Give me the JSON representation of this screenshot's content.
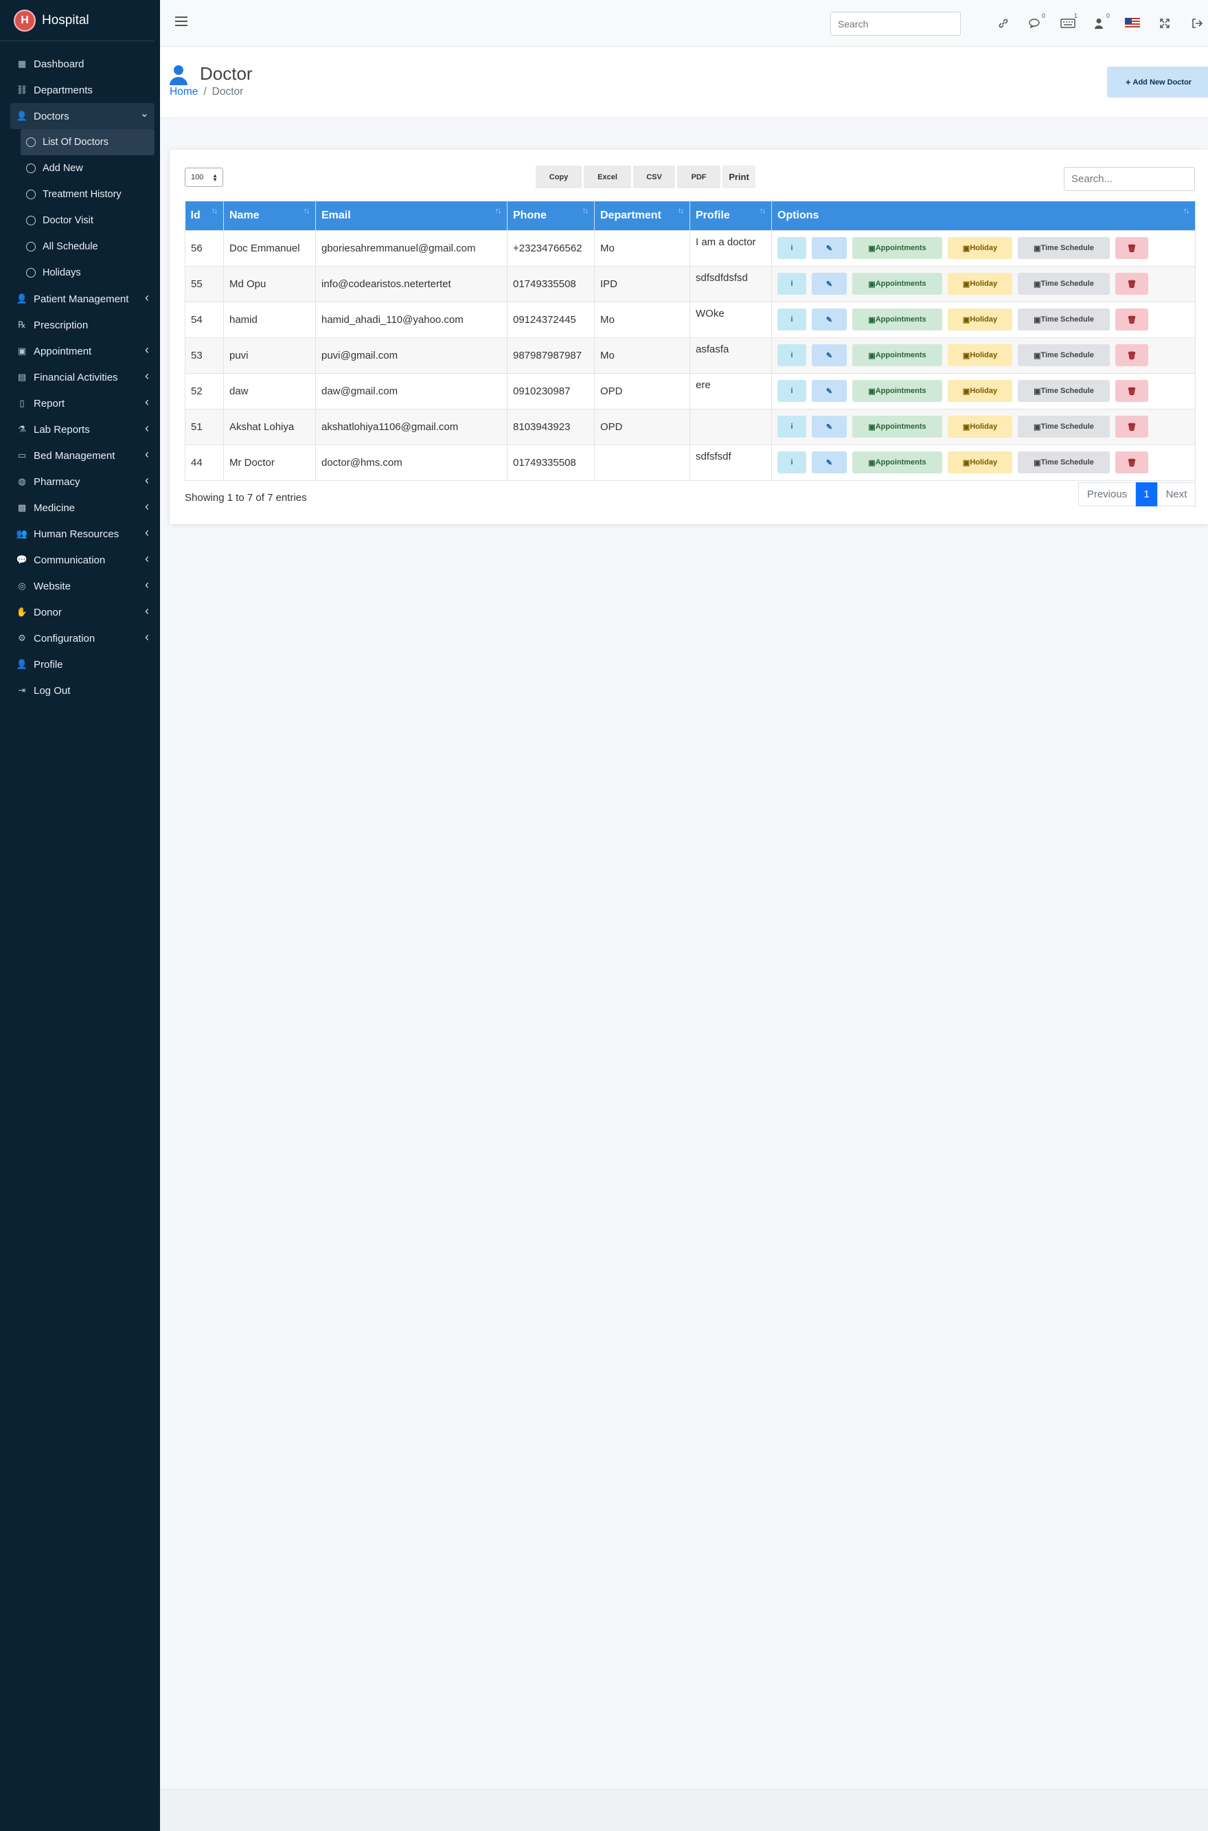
{
  "brand": {
    "name": "Hospital",
    "logo_letter": "H"
  },
  "sidebar": {
    "items": [
      {
        "label": "Dashboard",
        "icon": "grid-icon",
        "chevron": false
      },
      {
        "label": "Departments",
        "icon": "sitemap-icon",
        "chevron": false
      },
      {
        "label": "Doctors",
        "icon": "user-md-icon",
        "chevron": "down",
        "active": true
      },
      {
        "label": "Patient Management",
        "icon": "user-icon",
        "chevron": "left"
      },
      {
        "label": "Prescription",
        "icon": "prescription-icon",
        "chevron": false
      },
      {
        "label": "Appointment",
        "icon": "calendar-check-icon",
        "chevron": "left"
      },
      {
        "label": "Financial Activities",
        "icon": "money-icon",
        "chevron": "left"
      },
      {
        "label": "Report",
        "icon": "file-icon",
        "chevron": "left"
      },
      {
        "label": "Lab Reports",
        "icon": "flask-icon",
        "chevron": "left"
      },
      {
        "label": "Bed Management",
        "icon": "bed-icon",
        "chevron": "left"
      },
      {
        "label": "Pharmacy",
        "icon": "pills-icon",
        "chevron": "left"
      },
      {
        "label": "Medicine",
        "icon": "medkit-icon",
        "chevron": "left"
      },
      {
        "label": "Human Resources",
        "icon": "users-icon",
        "chevron": "left"
      },
      {
        "label": "Communication",
        "icon": "comments-icon",
        "chevron": "left"
      },
      {
        "label": "Website",
        "icon": "globe-icon",
        "chevron": "left"
      },
      {
        "label": "Donor",
        "icon": "hand-holding-icon",
        "chevron": "left"
      },
      {
        "label": "Configuration",
        "icon": "gear-icon",
        "chevron": "left"
      },
      {
        "label": "Profile",
        "icon": "user-icon",
        "chevron": false
      },
      {
        "label": "Log Out",
        "icon": "sign-out-icon",
        "chevron": false
      }
    ],
    "doctor_sub": [
      {
        "label": "List Of Doctors",
        "active": true
      },
      {
        "label": "Add New"
      },
      {
        "label": "Treatment History"
      },
      {
        "label": "Doctor Visit"
      },
      {
        "label": "All Schedule"
      },
      {
        "label": "Holidays"
      }
    ]
  },
  "topbar": {
    "search_placeholder": "Search",
    "icons": [
      "link-icon",
      "comments-icon",
      "keyboard-icon",
      "user-plus-icon",
      "us-flag-icon",
      "expand-icon",
      "sign-out-icon"
    ],
    "badges": {
      "comments": "0",
      "keyboard": "1",
      "user": "0"
    }
  },
  "header": {
    "title": "Doctor",
    "breadcrumb_home": "Home",
    "breadcrumb_sep": "/",
    "breadcrumb_current": "Doctor",
    "add_button": "Add New Doctor",
    "add_button_icon": "plus-icon"
  },
  "table_controls": {
    "length_value": "100",
    "buttons": [
      "Copy",
      "Excel",
      "CSV",
      "PDF",
      "Print"
    ],
    "search_placeholder": "Search..."
  },
  "table": {
    "columns": [
      "Id",
      "Name",
      "Email",
      "Phone",
      "Department",
      "Profile",
      "Options"
    ],
    "rows": [
      {
        "id": "56",
        "name": "Doc Emmanuel",
        "email": "gboriesahremmanuel@gmail.com",
        "phone": "+23234766562",
        "department": "Mo",
        "profile": "I am a doctor"
      },
      {
        "id": "55",
        "name": "Md Opu",
        "email": "info@codearistos.netertertet",
        "phone": "01749335508",
        "department": "IPD",
        "profile": "sdfsdfdsfsd"
      },
      {
        "id": "54",
        "name": "hamid",
        "email": "hamid_ahadi_110@yahoo.com",
        "phone": "09124372445",
        "department": "Mo",
        "profile": "WOke"
      },
      {
        "id": "53",
        "name": "puvi",
        "email": "puvi@gmail.com",
        "phone": "987987987987",
        "department": "Mo",
        "profile": "asfasfa"
      },
      {
        "id": "52",
        "name": "daw",
        "email": "daw@gmail.com",
        "phone": "0910230987",
        "department": "OPD",
        "profile": "ere"
      },
      {
        "id": "51",
        "name": "Akshat Lohiya",
        "email": "akshatlohiya1106@gmail.com",
        "phone": "8103943923",
        "department": "OPD",
        "profile": ""
      },
      {
        "id": "44",
        "name": "Mr Doctor",
        "email": "doctor@hms.com",
        "phone": "01749335508",
        "department": "",
        "profile": "sdfsfsdf"
      }
    ],
    "option_labels": {
      "info": "i",
      "edit": "✎",
      "appointments": "Appointments",
      "holiday": "Holiday",
      "time_schedule": "Time Schedule",
      "delete": "🗑"
    }
  },
  "footer_info": "Showing 1 to 7 of 7 entries",
  "pagination": {
    "previous": "Previous",
    "current": "1",
    "next": "Next"
  },
  "colors": {
    "sidebar_bg": "#0b2233",
    "table_header": "#3a8ee0",
    "primary": "#0d6efd"
  }
}
